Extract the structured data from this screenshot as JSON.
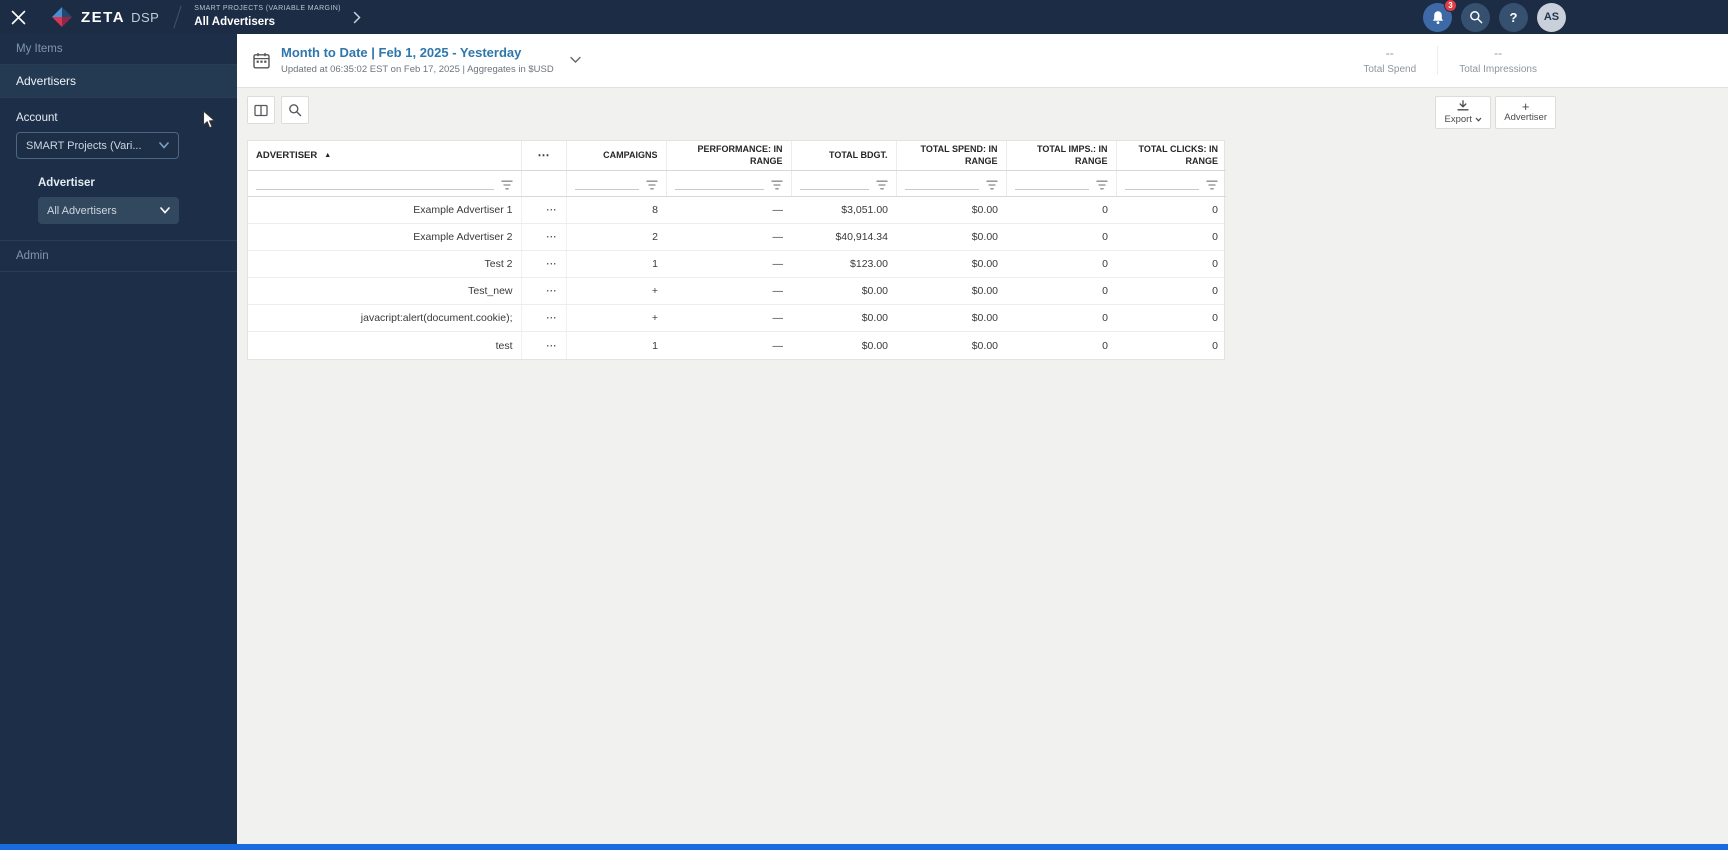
{
  "topbar": {
    "brand": "ZETA",
    "product": "DSP",
    "breadcrumb_project": "SMART PROJECTS (VARIABLE MARGIN)",
    "breadcrumb_page": "All Advertisers",
    "notification_count": "3",
    "help_glyph": "?",
    "avatar_initials": "AS"
  },
  "sidebar": {
    "my_items": "My Items",
    "advertisers": "Advertisers",
    "account_label": "Account",
    "account_value": "SMART Projects (Vari...",
    "advertiser_label": "Advertiser",
    "advertiser_value": "All Advertisers",
    "admin": "Admin"
  },
  "header": {
    "date_title": "Month to Date | Feb 1, 2025 - Yesterday",
    "date_subtitle": "Updated at 06:35:02 EST on Feb 17, 2025 | Aggregates in $USD",
    "stats": [
      {
        "value": "--",
        "label": "Total Spend"
      },
      {
        "value": "--",
        "label": "Total Impressions"
      }
    ]
  },
  "toolbar": {
    "export_label": "Export",
    "add_label": "Advertiser",
    "plus_glyph": "+"
  },
  "table": {
    "columns": {
      "advertiser": "ADVERTISER",
      "options": "⋯",
      "campaigns": "CAMPAIGNS",
      "performance": "PERFORMANCE: IN RANGE",
      "budget": "TOTAL BDGT.",
      "spend": "TOTAL SPEND: IN RANGE",
      "imps": "TOTAL IMPS.: IN RANGE",
      "clicks": "TOTAL CLICKS: IN RANGE"
    },
    "sort_icon": "▲",
    "rows": [
      {
        "advertiser": "Example Advertiser 1",
        "options": "⋯",
        "campaigns": "8",
        "performance": "—",
        "budget": "$3,051.00",
        "spend": "$0.00",
        "imps": "0",
        "clicks": "0"
      },
      {
        "advertiser": "Example Advertiser 2",
        "options": "⋯",
        "campaigns": "2",
        "performance": "—",
        "budget": "$40,914.34",
        "spend": "$0.00",
        "imps": "0",
        "clicks": "0"
      },
      {
        "advertiser": "Test 2",
        "options": "⋯",
        "campaigns": "1",
        "performance": "—",
        "budget": "$123.00",
        "spend": "$0.00",
        "imps": "0",
        "clicks": "0"
      },
      {
        "advertiser": "Test_new",
        "options": "⋯",
        "campaigns": "+",
        "performance": "—",
        "budget": "$0.00",
        "spend": "$0.00",
        "imps": "0",
        "clicks": "0"
      },
      {
        "advertiser": "javacript:alert(document.cookie);",
        "options": "⋯",
        "campaigns": "+",
        "performance": "—",
        "budget": "$0.00",
        "spend": "$0.00",
        "imps": "0",
        "clicks": "0"
      },
      {
        "advertiser": "test",
        "options": "⋯",
        "campaigns": "1",
        "performance": "—",
        "budget": "$0.00",
        "spend": "$0.00",
        "imps": "0",
        "clicks": "0"
      }
    ]
  },
  "colors": {
    "navy": "#1b2c44",
    "sidebar_navy": "#1d2f48",
    "accent_blue": "#2e77ad",
    "badge_red": "#e23c44",
    "bottom_bar_blue": "#1a6be0"
  }
}
